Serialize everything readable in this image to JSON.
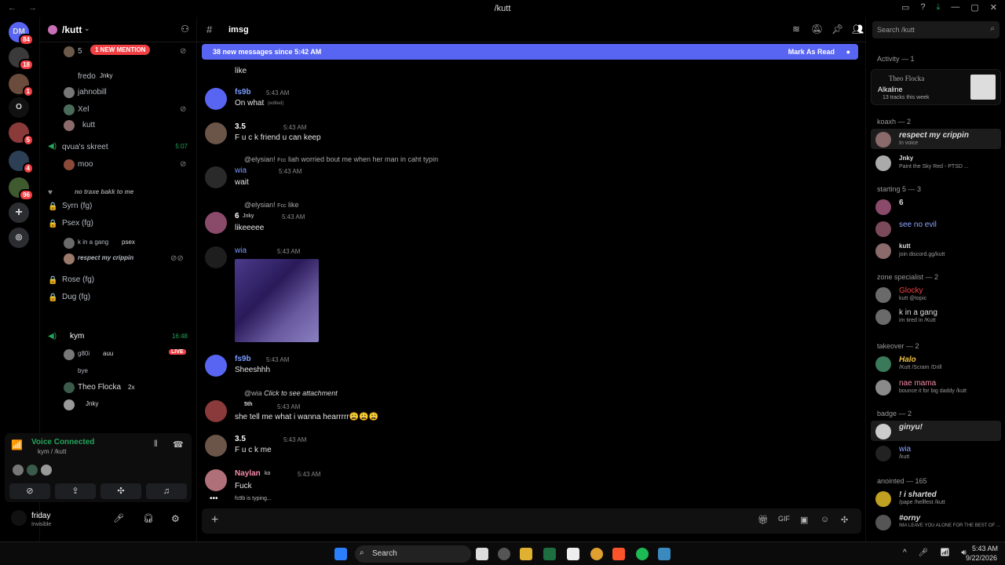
{
  "window": {
    "title": "/kutt",
    "nav": "← →"
  },
  "servers": [
    {
      "badge": "84",
      "label": "DM"
    },
    {
      "badge": "18",
      "label": ""
    },
    {
      "badge": "1",
      "label": ""
    },
    {
      "badge": "",
      "label": "O"
    },
    {
      "badge": "5",
      "label": ""
    },
    {
      "badge": "4",
      "label": ""
    },
    {
      "badge": "96",
      "label": ""
    }
  ],
  "channel_sidebar": {
    "server_name": "/kutt",
    "mention_pill": "1 NEW MENTION",
    "rows": [
      {
        "label": "5",
        "kind": "user"
      },
      {
        "label": "fredo",
        "tag": "Jnky",
        "kind": "user"
      },
      {
        "label": "jahnobill",
        "kind": "user"
      },
      {
        "label": "Xel",
        "kind": "user"
      },
      {
        "label": "kutt",
        "kind": "user"
      },
      {
        "label": "qvua's skreet",
        "time": "5:07",
        "kind": "voice"
      },
      {
        "label": "moo",
        "kind": "user"
      },
      {
        "label": "no traxe bakk to me",
        "kind": "category"
      },
      {
        "label": "Syrn (fg)",
        "kind": "locked"
      },
      {
        "label": "Psex (fg)",
        "kind": "locked"
      },
      {
        "label": "k in a gang",
        "tag": "psex",
        "kind": "user"
      },
      {
        "label": "respect my crippin",
        "kind": "user"
      },
      {
        "label": "Rose (fg)",
        "kind": "locked"
      },
      {
        "label": "Dug (fg)",
        "kind": "locked"
      },
      {
        "label": "kym",
        "time": "16:48",
        "kind": "voice"
      },
      {
        "label": "g80i",
        "tag": "auu",
        "live": "LIVE",
        "kind": "user"
      },
      {
        "label": "bye",
        "kind": "user"
      },
      {
        "label": "Theo Flocka",
        "tag": "2x",
        "kind": "user"
      },
      {
        "label": "Jnky",
        "kind": "user"
      }
    ],
    "voice": {
      "status": "Voice Connected",
      "channel": "kym / /kutt"
    },
    "user": {
      "name": "friday",
      "status": "Invisible"
    }
  },
  "main": {
    "channel": "imsg",
    "search_placeholder": "Search /kutt",
    "banner": {
      "text": "38 new messages since 5:42 AM",
      "action": "Mark As Read"
    },
    "typing": "fs9b is typing...",
    "messages": [
      {
        "author": "",
        "time": "",
        "text": "like"
      },
      {
        "author": "fs9b",
        "time": "5:43 AM",
        "text": "On what",
        "edited": "(edited)"
      },
      {
        "author": "3.5",
        "time": "5:43 AM",
        "text": "F u c k friend u can keep"
      },
      {
        "author": "wia",
        "time": "5:43 AM",
        "text": "wait",
        "reply_user": "@elysian!",
        "reply_tag": "Fcc",
        "reply_text": "liah worried bout me when her man in caht typin"
      },
      {
        "author": "6",
        "tag": "Jnky",
        "time": "5:43 AM",
        "text": "likeeeee",
        "reply_user": "@elysian!",
        "reply_tag": "Fcc",
        "reply_text": "like"
      },
      {
        "author": "wia",
        "time": "5:43 AM",
        "text": ""
      },
      {
        "author": "fs9b",
        "time": "5:43 AM",
        "text": "Sheeshhh"
      },
      {
        "author": "",
        "tag": "5th",
        "time": "5:43 AM",
        "text": "she tell me what i wanna hearrrrr😩😩😩",
        "reply_user": "@wia",
        "reply_text": "Click to see attachment"
      },
      {
        "author": "3.5",
        "time": "5:43 AM",
        "text": "F u c k me"
      },
      {
        "author": "Naylan",
        "tag": "ko",
        "time": "5:43 AM",
        "text": "Fuck"
      }
    ]
  },
  "members": {
    "activity_header": "Activity — 1",
    "activity": {
      "user": "Theo Flocka",
      "title": "Alkaline",
      "detail": "13 tracks this week"
    },
    "groups": [
      {
        "name": "koaxh — 2",
        "members": [
          {
            "name": "respect my crippin",
            "sub": "In voice"
          },
          {
            "name": "Jnky",
            "sub": "Paint the Sky Red - PTSD ..."
          }
        ]
      },
      {
        "name": "starting 5 — 3",
        "members": [
          {
            "name": "6",
            "sub": ""
          },
          {
            "name": "see no evil",
            "sub": ""
          },
          {
            "name": "kutt",
            "sub": "join discord.gg/kutt"
          }
        ]
      },
      {
        "name": "zone specialist — 2",
        "members": [
          {
            "name": "Glocky",
            "sub": "kutt @topic"
          },
          {
            "name": "k in a gang",
            "sub": "im tired in /Kutt"
          }
        ]
      },
      {
        "name": "takeover — 2",
        "members": [
          {
            "name": "Halo",
            "sub": "/Kutt /Scram /Drill"
          },
          {
            "name": "nae mama",
            "sub": "bounce it for big daddy /kutt"
          }
        ]
      },
      {
        "name": "badge — 2",
        "members": [
          {
            "name": "ginyu!",
            "sub": ""
          },
          {
            "name": "wia",
            "sub": "/kutt"
          }
        ]
      },
      {
        "name": "anointed — 165",
        "members": [
          {
            "name": "! i sharted",
            "sub": "/pape /hellfest /kutt"
          },
          {
            "name": "#orny",
            "sub": "IMA LEAVE YOU ALONE FOR THE BEST OF ..."
          }
        ]
      }
    ]
  },
  "taskbar": {
    "search": "Search",
    "time": "5:43 AM",
    "date": "9/22/2026"
  },
  "colors": {
    "accent": "#5865f2",
    "live": "#f23f43",
    "voice": "#23a55a",
    "mention": "#ed4245"
  }
}
